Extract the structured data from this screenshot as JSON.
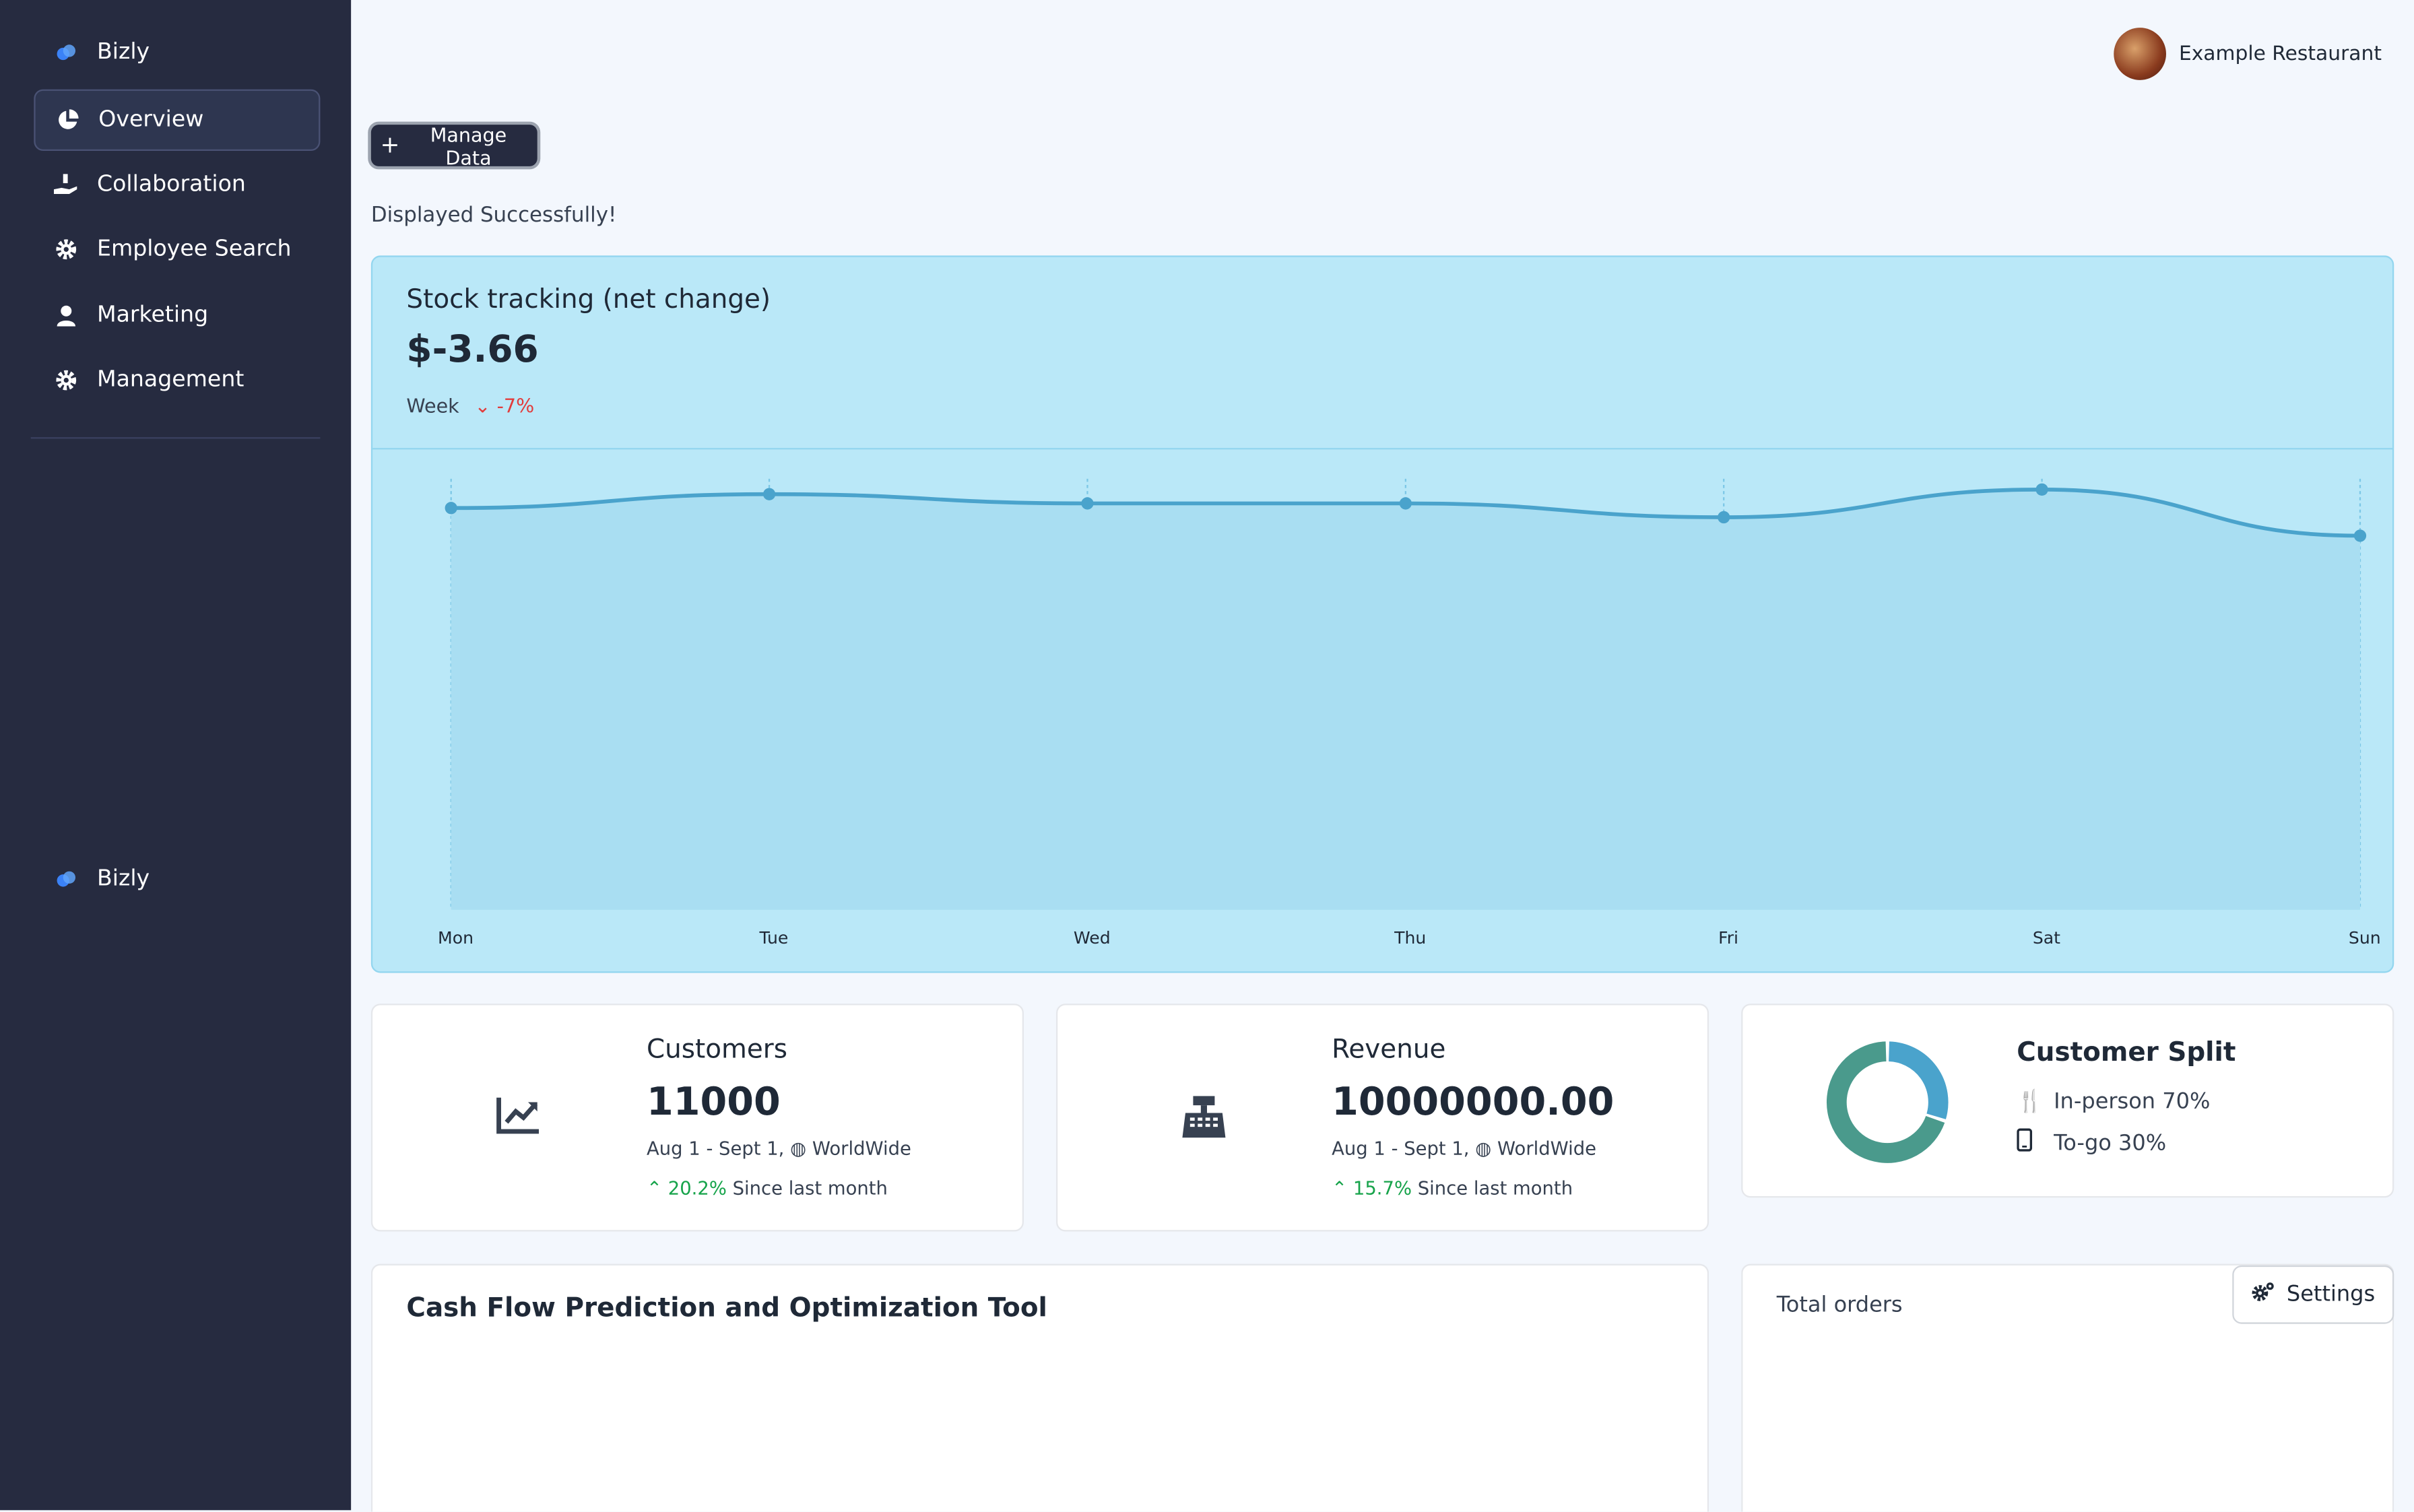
{
  "sidebar": {
    "brand": "Bizly",
    "items": [
      {
        "label": "Overview",
        "icon": "pie-chart-icon"
      },
      {
        "label": "Collaboration",
        "icon": "hand-holding-icon"
      },
      {
        "label": "Employee Search",
        "icon": "gear-icon"
      },
      {
        "label": "Marketing",
        "icon": "user-icon"
      },
      {
        "label": "Management",
        "icon": "gear-icon"
      }
    ],
    "footer_brand": "Bizly"
  },
  "header": {
    "user_name": "Example Restaurant"
  },
  "actions": {
    "manage_label": "Manage Data"
  },
  "status_message": "Displayed Successfully!",
  "stock": {
    "title": "Stock tracking (net change)",
    "value": "$-3.66",
    "period": "Week",
    "change": "-7%"
  },
  "chart_data": {
    "type": "area",
    "categories": [
      "Mon",
      "Tue",
      "Wed",
      "Thu",
      "Fri",
      "Sat",
      "Sun"
    ],
    "values": [
      0.87,
      0.9,
      0.88,
      0.88,
      0.85,
      0.91,
      0.81
    ],
    "ylim": [
      0,
      1
    ],
    "grid": true,
    "color": "#4aa3cc"
  },
  "customers": {
    "title": "Customers",
    "value": "11000",
    "range": "Aug 1 - Sept 1,",
    "region": "WorldWide",
    "change": "20.2%",
    "since": "Since last month"
  },
  "revenue": {
    "title": "Revenue",
    "value": "10000000.00",
    "range": "Aug 1 - Sept 1,",
    "region": "WorldWide",
    "change": "15.7%",
    "since": "Since last month"
  },
  "split": {
    "title": "Customer Split",
    "inperson": "In-person 70%",
    "togo": "To-go 30%",
    "inperson_value": 70,
    "togo_value": 30,
    "colors": {
      "inperson": "#4a9a8c",
      "togo": "#4aa3cc"
    }
  },
  "cashflow": {
    "title": "Cash Flow Prediction and Optimization Tool"
  },
  "orders": {
    "title": "Total orders"
  },
  "settings": {
    "label": "Settings"
  }
}
